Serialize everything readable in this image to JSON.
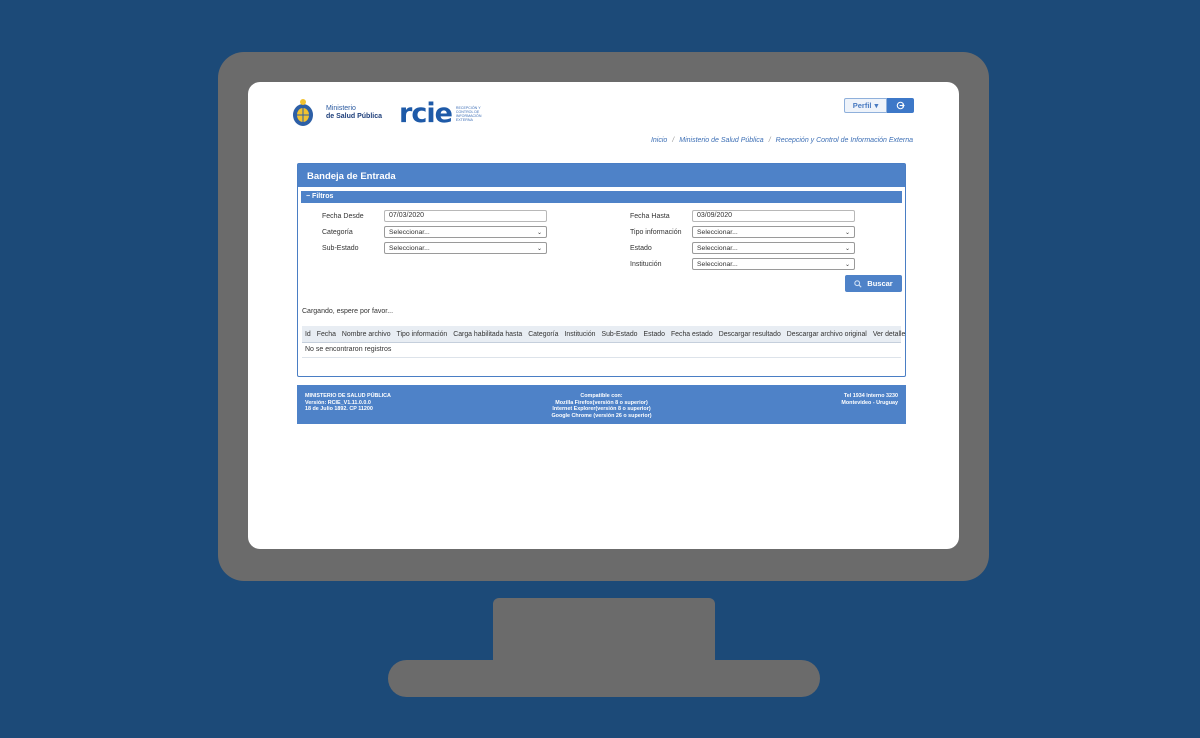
{
  "header": {
    "ministry_line1": "Ministerio",
    "ministry_line2": "de Salud Pública",
    "rcie_logo": "rcie",
    "rcie_sub": "Recepción y Control de Información Externa",
    "perfil_label": "Perfil",
    "logout_icon": "logout-icon"
  },
  "breadcrumb": [
    "Inicio",
    "Ministerio de Salud Pública",
    "Recepción y Control de Información Externa"
  ],
  "panel": {
    "title": "Bandeja de Entrada",
    "filtros_label": "Filtros"
  },
  "filters": {
    "fecha_desde_label": "Fecha Desde",
    "fecha_desde_value": "07/03/2020",
    "fecha_hasta_label": "Fecha Hasta",
    "fecha_hasta_value": "03/09/2020",
    "categoria_label": "Categoría",
    "categoria_value": "Seleccionar...",
    "tipo_label": "Tipo información",
    "tipo_value": "Seleccionar...",
    "subestado_label": "Sub-Estado",
    "subestado_value": "Seleccionar...",
    "estado_label": "Estado",
    "estado_value": "Seleccionar...",
    "institucion_label": "Institución",
    "institucion_value": "Seleccionar...",
    "buscar_label": "Buscar"
  },
  "loading_text": "Cargando, espere por favor...",
  "table": {
    "columns": [
      "Id",
      "Fecha",
      "Nombre archivo",
      "Tipo información",
      "Carga habilitada hasta",
      "Categoría",
      "Institución",
      "Sub-Estado",
      "Estado",
      "Fecha estado",
      "Descargar resultado",
      "Descargar archivo original",
      "Ver detalle"
    ],
    "empty_text": "No se encontraron registros"
  },
  "footer": {
    "left1": "MINISTERIO DE SALUD PÚBLICA",
    "left2": "Versión: RCIE_V1.11.0.0.0",
    "left3": "18 de Julio 1892. CP 11200",
    "mid1": "Compatible con:",
    "mid2": "Mozilla Firefox(versión 8 o superior)",
    "mid3": "Internet Explorer(versión 8 o superior)",
    "mid4": "Google Chrome (versión 26 o superior)",
    "right1": "Tel 1934 Interno 3230",
    "right2": "Montevideo - Uruguay"
  },
  "colors": {
    "background": "#1c4a78",
    "monitor": "#6b6b6b",
    "accent": "#4e82c8"
  }
}
